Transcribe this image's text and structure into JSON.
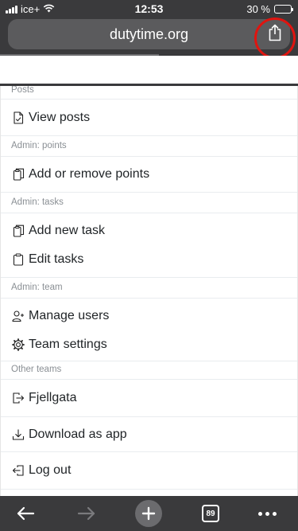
{
  "statusbar": {
    "carrier": "ice+",
    "time": "12:53",
    "battery_text": "30 %",
    "battery_level": 0.3,
    "battery_color": "#ffd60a"
  },
  "browser": {
    "url": "dutytime.org",
    "share_icon": "share-icon",
    "highlight_color": "#e0140f"
  },
  "menu": {
    "sections": {
      "posts": "Posts",
      "admin_points": "Admin: points",
      "admin_tasks": "Admin: tasks",
      "admin_team": "Admin: team",
      "other_teams": "Other teams"
    },
    "items": {
      "view_posts": {
        "label": "View posts",
        "icon": "file-check-icon"
      },
      "add_remove_points": {
        "label": "Add or remove points",
        "icon": "clipboard-copy-icon"
      },
      "add_new_task": {
        "label": "Add new task",
        "icon": "clipboard-copy-icon"
      },
      "edit_tasks": {
        "label": "Edit tasks",
        "icon": "clipboard-icon"
      },
      "manage_users": {
        "label": "Manage users",
        "icon": "user-plus-icon"
      },
      "team_settings": {
        "label": "Team settings",
        "icon": "gear-icon"
      },
      "fjellgata": {
        "label": "Fjellgata",
        "icon": "box-arrow-right-icon"
      },
      "download_app": {
        "label": "Download as app",
        "icon": "download-icon"
      },
      "log_out": {
        "label": "Log out",
        "icon": "box-arrow-left-icon"
      }
    }
  },
  "toolbar": {
    "tab_count": "89",
    "back_icon": "arrow-left-icon",
    "forward_icon": "arrow-right-icon",
    "new_tab_icon": "plus-icon",
    "more_icon": "more-dots-icon"
  }
}
